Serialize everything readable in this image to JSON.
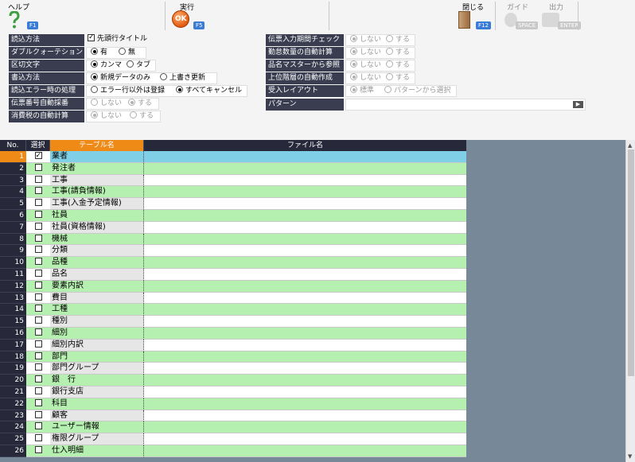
{
  "toolbar": {
    "help": {
      "label": "ヘルプ",
      "key": "F1"
    },
    "run": {
      "label": "実行",
      "key": "F5",
      "icon_text": "OK"
    },
    "close": {
      "label": "閉じる",
      "key": "F12"
    },
    "guide": {
      "label": "ガイド",
      "key": "SPACE"
    },
    "output": {
      "label": "出力",
      "key": "ENTER"
    }
  },
  "settings": {
    "read_method": {
      "label": "読込方法",
      "opt1": "先頭行タイトル",
      "checked": true
    },
    "double_quote": {
      "label": "ダブルクォーテション",
      "opt1": "有",
      "opt2": "無"
    },
    "delimiter": {
      "label": "区切文字",
      "opt1": "カンマ",
      "opt2": "タブ"
    },
    "write_method": {
      "label": "書込方法",
      "opt1": "新規データのみ",
      "opt2": "上書き更新"
    },
    "error_handling": {
      "label": "読込エラー時の処理",
      "opt1": "エラー行以外は登録",
      "opt2": "すべてキャンセル"
    },
    "slip_auto_number": {
      "label": "伝票番号自動採番",
      "opt1": "しない",
      "opt2": "する"
    },
    "consumption_tax": {
      "label": "消費税の自動計算",
      "opt1": "しない",
      "opt2": "する"
    },
    "slip_period_check": {
      "label": "伝票入力期間チェック",
      "opt1": "しない",
      "opt2": "する"
    },
    "attendance_calc": {
      "label": "勤怠数量の自動計算",
      "opt1": "しない",
      "opt2": "する"
    },
    "item_master_ref": {
      "label": "品名マスターから参照",
      "opt1": "しない",
      "opt2": "する"
    },
    "upper_level_auto": {
      "label": "上位階層の自動作成",
      "opt1": "しない",
      "opt2": "する"
    },
    "receive_layout": {
      "label": "受入レイアウト",
      "opt1": "標準",
      "opt2": "パターンから選択"
    },
    "pattern": {
      "label": "パターン",
      "value": "",
      "button": "▶"
    }
  },
  "grid": {
    "headers": {
      "no": "No.",
      "select": "選択",
      "table": "テーブル名",
      "file": "ファイル名"
    },
    "rows": [
      {
        "no": "1",
        "name": "業者",
        "checked": true
      },
      {
        "no": "2",
        "name": "発注者",
        "checked": false
      },
      {
        "no": "3",
        "name": "工事",
        "checked": false
      },
      {
        "no": "4",
        "name": "工事(請負情報)",
        "checked": false
      },
      {
        "no": "5",
        "name": "工事(入金予定情報)",
        "checked": false
      },
      {
        "no": "6",
        "name": "社員",
        "checked": false
      },
      {
        "no": "7",
        "name": "社員(資格情報)",
        "checked": false
      },
      {
        "no": "8",
        "name": "機械",
        "checked": false
      },
      {
        "no": "9",
        "name": "分類",
        "checked": false
      },
      {
        "no": "10",
        "name": "品種",
        "checked": false
      },
      {
        "no": "11",
        "name": "品名",
        "checked": false
      },
      {
        "no": "12",
        "name": "要素内訳",
        "checked": false
      },
      {
        "no": "13",
        "name": "費目",
        "checked": false
      },
      {
        "no": "14",
        "name": "工種",
        "checked": false
      },
      {
        "no": "15",
        "name": "種別",
        "checked": false
      },
      {
        "no": "16",
        "name": "細別",
        "checked": false
      },
      {
        "no": "17",
        "name": "細別内訳",
        "checked": false
      },
      {
        "no": "18",
        "name": "部門",
        "checked": false
      },
      {
        "no": "19",
        "name": "部門グループ",
        "checked": false
      },
      {
        "no": "20",
        "name": "銀　行",
        "checked": false
      },
      {
        "no": "21",
        "name": "銀行支店",
        "checked": false
      },
      {
        "no": "22",
        "name": "科目",
        "checked": false
      },
      {
        "no": "23",
        "name": "顧客",
        "checked": false
      },
      {
        "no": "24",
        "name": "ユーザー情報",
        "checked": false
      },
      {
        "no": "25",
        "name": "権限グループ",
        "checked": false
      },
      {
        "no": "26",
        "name": "仕入明細",
        "checked": false
      }
    ]
  },
  "colors": {
    "label_bg": "#3a3d50",
    "accent_orange": "#ef8a17",
    "row_green": "#b6f0b0",
    "row_current": "#7fd0e6",
    "grid_bg": "#778899"
  }
}
